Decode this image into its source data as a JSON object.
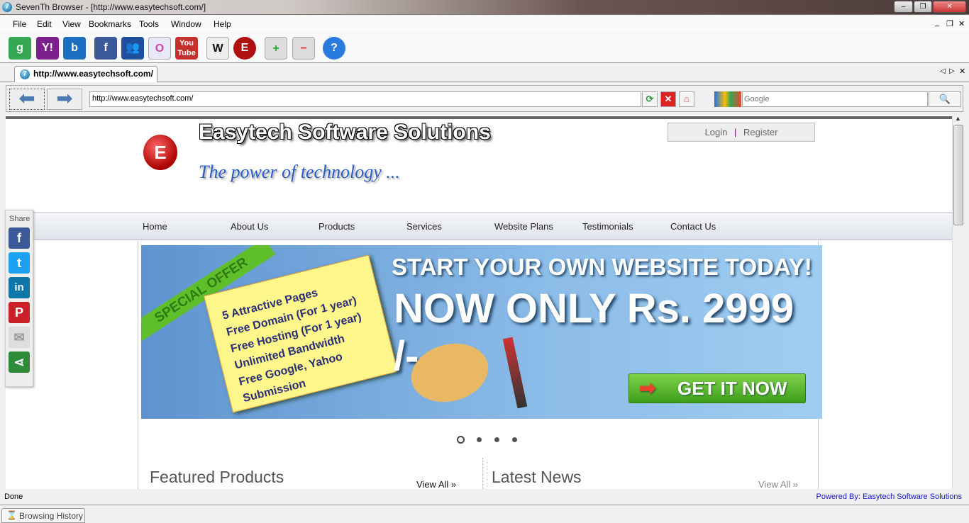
{
  "window": {
    "title": "SevenTh Browser - [http://www.easytechsoft.com/]",
    "minimize": "–",
    "restore": "❐",
    "close": "✕"
  },
  "menu": [
    "File",
    "Edit",
    "View",
    "Bookmarks",
    "Tools",
    "Window",
    "Help"
  ],
  "toolbar": [
    {
      "name": "google",
      "label": "g",
      "color": "#34a853"
    },
    {
      "name": "yahoo",
      "label": "Y!",
      "color": "#7b1f8c"
    },
    {
      "name": "bing",
      "label": "b",
      "color": "#1c6fc0"
    },
    {
      "name": "facebook",
      "label": "f",
      "color": "#3b5998"
    },
    {
      "name": "myspace",
      "label": "👥",
      "color": "#1d4f9c"
    },
    {
      "name": "orkut",
      "label": "O",
      "color": "#e8e8f8"
    },
    {
      "name": "youtube",
      "label": "You Tube",
      "color": "#c4302b"
    },
    {
      "name": "wikipedia",
      "label": "W",
      "color": "#eeeeee"
    },
    {
      "name": "easytech",
      "label": "E",
      "color": "#b01010"
    },
    {
      "name": "add-bookmark",
      "label": "+",
      "color": "#dddddd"
    },
    {
      "name": "remove-bookmark",
      "label": "−",
      "color": "#dddddd"
    },
    {
      "name": "help",
      "label": "?",
      "color": "#2a7be0"
    }
  ],
  "tab": {
    "label": "http://www.easytechsoft.com/"
  },
  "nav": {
    "url": "http://www.easytechsoft.com/",
    "search_placeholder": "Google"
  },
  "page": {
    "site_title": "Easytech Software Solutions",
    "tagline": "The power of technology ...",
    "login": "Login",
    "separator": "|",
    "register": "Register",
    "menu": [
      "Home",
      "About Us",
      "Products",
      "Services",
      "Website Plans",
      "Testimonials",
      "Contact Us"
    ],
    "share_label": "Share",
    "banner": {
      "ribbon": "SPECIAL OFFER",
      "features": [
        "5 Attractive Pages",
        "Free Domain (For 1 year)",
        "Free Hosting (For 1 year)",
        "Unlimited Bandwidth",
        "Free Google, Yahoo",
        "Submission"
      ],
      "headline": "START YOUR OWN WEBSITE TODAY!",
      "price": "NOW ONLY Rs. 2999 /-",
      "cta": "GET IT NOW"
    },
    "slides": {
      "count": 4,
      "active": 1
    },
    "featured_title": "Featured Products",
    "featured_link": "View All »",
    "news_title": "Latest News",
    "news_link": "View All »"
  },
  "status": {
    "text": "Done",
    "powered": "Powered By: Easytech Software Solutions"
  },
  "bottom": {
    "history": "Browsing History"
  }
}
